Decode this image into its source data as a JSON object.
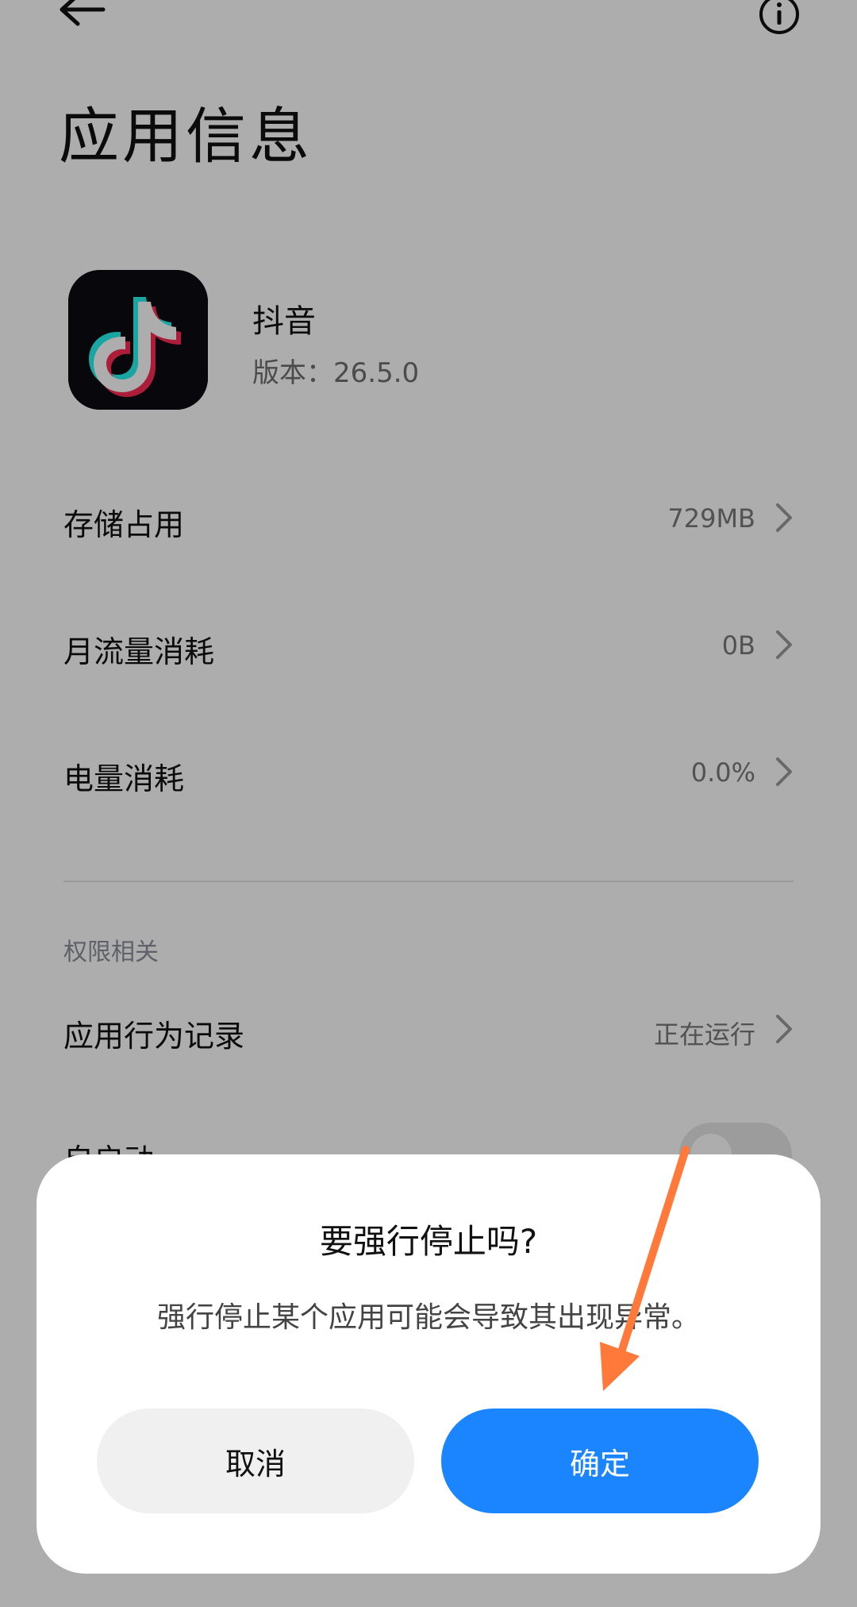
{
  "header": {
    "title": "应用信息",
    "back_icon": "arrow-left-icon",
    "info_icon": "info-circle-icon"
  },
  "app": {
    "name": "抖音",
    "version": "版本：26.5.0",
    "icon": "tiktok-logo-icon"
  },
  "settings": {
    "storage_label": "存储占用",
    "storage_value": "729MB",
    "data_label": "月流量消耗",
    "data_value": "0B",
    "battery_label": "电量消耗",
    "battery_value": "0.0%",
    "section_permissions": "权限相关",
    "behavior_label": "应用行为记录",
    "behavior_value": "正在运行",
    "autostart_label_partial": "自启动"
  },
  "dialog": {
    "title": "要强行停止吗?",
    "message": "强行停止某个应用可能会导致其出现异常。",
    "cancel_label": "取消",
    "confirm_label": "确定"
  },
  "colors": {
    "accent": "#1a85ff",
    "arrow": "#ff7a3a",
    "overlay": "rgba(0,0,0,0.32)"
  }
}
